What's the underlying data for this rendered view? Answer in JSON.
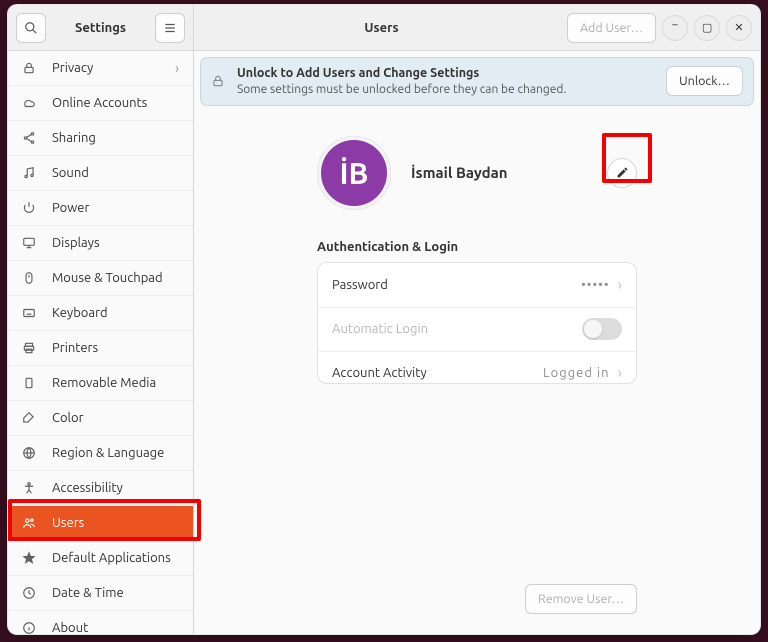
{
  "header": {
    "settings_title": "Settings",
    "page_title": "Users",
    "add_user_label": "Add User…"
  },
  "infobar": {
    "title": "Unlock to Add Users and Change Settings",
    "subtitle": "Some settings must be unlocked before they can be changed.",
    "unlock_label": "Unlock…"
  },
  "sidebar": {
    "items": [
      {
        "icon": "lock",
        "label": "Privacy",
        "chev": true
      },
      {
        "icon": "cloud",
        "label": "Online Accounts"
      },
      {
        "icon": "share",
        "label": "Sharing"
      },
      {
        "icon": "note",
        "label": "Sound"
      },
      {
        "icon": "power",
        "label": "Power"
      },
      {
        "icon": "display",
        "label": "Displays"
      },
      {
        "icon": "mouse",
        "label": "Mouse & Touchpad"
      },
      {
        "icon": "keyboard",
        "label": "Keyboard"
      },
      {
        "icon": "printer",
        "label": "Printers"
      },
      {
        "icon": "removable",
        "label": "Removable Media"
      },
      {
        "icon": "color",
        "label": "Color"
      },
      {
        "icon": "globe",
        "label": "Region & Language"
      },
      {
        "icon": "access",
        "label": "Accessibility"
      },
      {
        "icon": "users",
        "label": "Users",
        "active": true
      },
      {
        "icon": "star",
        "label": "Default Applications"
      },
      {
        "icon": "clock",
        "label": "Date & Time"
      },
      {
        "icon": "info",
        "label": "About"
      }
    ]
  },
  "user": {
    "initials": "İB",
    "name": "İsmail Baydan"
  },
  "auth": {
    "section_title": "Authentication & Login",
    "rows": [
      {
        "label": "Password",
        "value": "•••••",
        "chev": true,
        "disabled": false,
        "switch": false
      },
      {
        "label": "Automatic Login",
        "value": "",
        "chev": false,
        "disabled": true,
        "switch": true
      },
      {
        "label": "Account Activity",
        "value": "Logged in",
        "chev": true,
        "disabled": false,
        "switch": false
      }
    ]
  },
  "footer": {
    "remove_label": "Remove User…"
  }
}
